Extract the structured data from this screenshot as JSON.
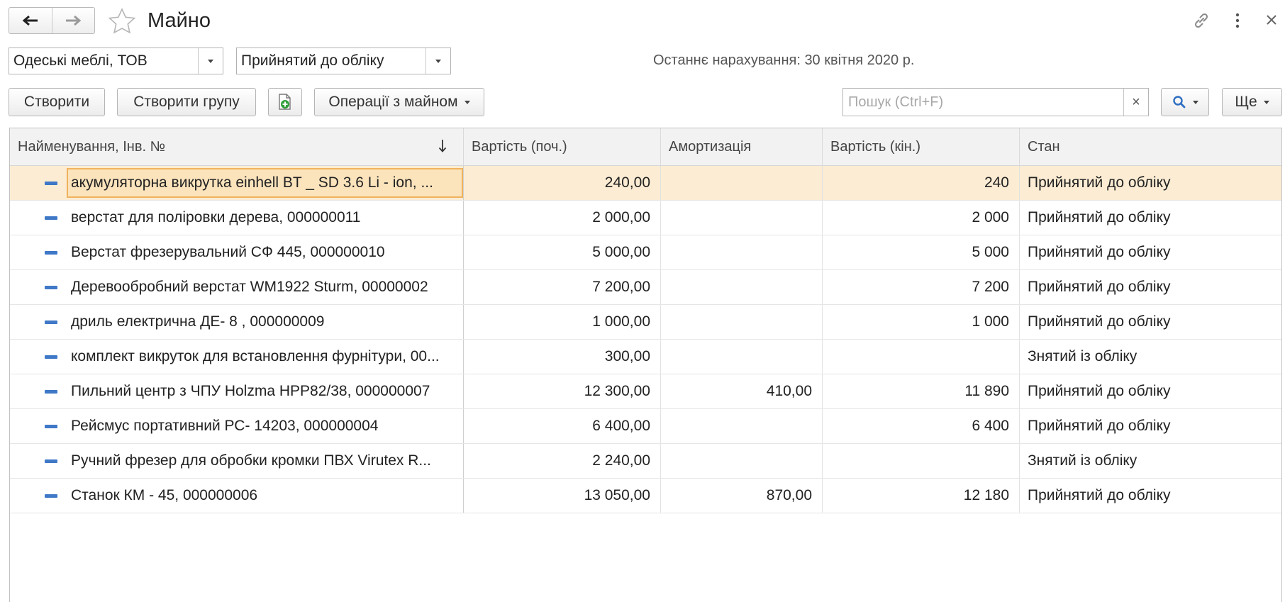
{
  "window": {
    "title": "Майно"
  },
  "filters": {
    "organization": "Одеські меблі, ТОВ",
    "status": "Прийнятий до обліку",
    "last_accrual": "Останнє нарахування: 30 квітня 2020 р."
  },
  "toolbar": {
    "create_label": "Створити",
    "create_group_label": "Створити групу",
    "operations_label": "Операції з майном",
    "search_placeholder": "Пошук (Ctrl+F)",
    "search_clear": "×",
    "more_label": "Ще"
  },
  "table": {
    "columns": [
      "Найменування, Інв. №",
      "Вартість (поч.)",
      "Амортизація",
      "Вартість (кін.)",
      "Стан"
    ],
    "rows": [
      {
        "name": "акумуляторна викрутка einhell BT _ SD 3.6 Li - ion, ...",
        "cost_start": "240,00",
        "amortization": "",
        "cost_end": "240",
        "state": "Прийнятий до обліку"
      },
      {
        "name": "верстат для поліровки дерева, 000000011",
        "cost_start": "2 000,00",
        "amortization": "",
        "cost_end": "2 000",
        "state": "Прийнятий до обліку"
      },
      {
        "name": "Верстат фрезерувальний СФ 445, 000000010",
        "cost_start": "5 000,00",
        "amortization": "",
        "cost_end": "5 000",
        "state": "Прийнятий до обліку"
      },
      {
        "name": "Деревообробний верстат WM1922 Sturm, 00000002",
        "cost_start": "7 200,00",
        "amortization": "",
        "cost_end": "7 200",
        "state": "Прийнятий до обліку"
      },
      {
        "name": "дриль електрична ДЕ- 8 , 000000009",
        "cost_start": "1 000,00",
        "amortization": "",
        "cost_end": "1 000",
        "state": "Прийнятий до обліку"
      },
      {
        "name": "комплект викруток для встановлення фурнітури, 00...",
        "cost_start": "300,00",
        "amortization": "",
        "cost_end": "",
        "state": "Знятий із обліку"
      },
      {
        "name": "Пильний центр з ЧПУ Holzma HPP82/38, 000000007",
        "cost_start": "12 300,00",
        "amortization": "410,00",
        "cost_end": "11 890",
        "state": "Прийнятий до обліку"
      },
      {
        "name": "Рейсмус портативний РС- 14203, 000000004",
        "cost_start": "6 400,00",
        "amortization": "",
        "cost_end": "6 400",
        "state": "Прийнятий до обліку"
      },
      {
        "name": "Ручний фрезер для обробки кромки ПВХ Virutex R...",
        "cost_start": "2 240,00",
        "amortization": "",
        "cost_end": "",
        "state": "Знятий із обліку"
      },
      {
        "name": "Станок КМ - 45, 000000006",
        "cost_start": "13 050,00",
        "amortization": "870,00",
        "cost_end": "12 180",
        "state": "Прийнятий до обліку"
      }
    ]
  },
  "colors": {
    "selected_row": "#fbecd3",
    "selected_border": "#f0b35e",
    "item_icon": "#3f78c7",
    "add_icon": "#2f9e3a"
  }
}
